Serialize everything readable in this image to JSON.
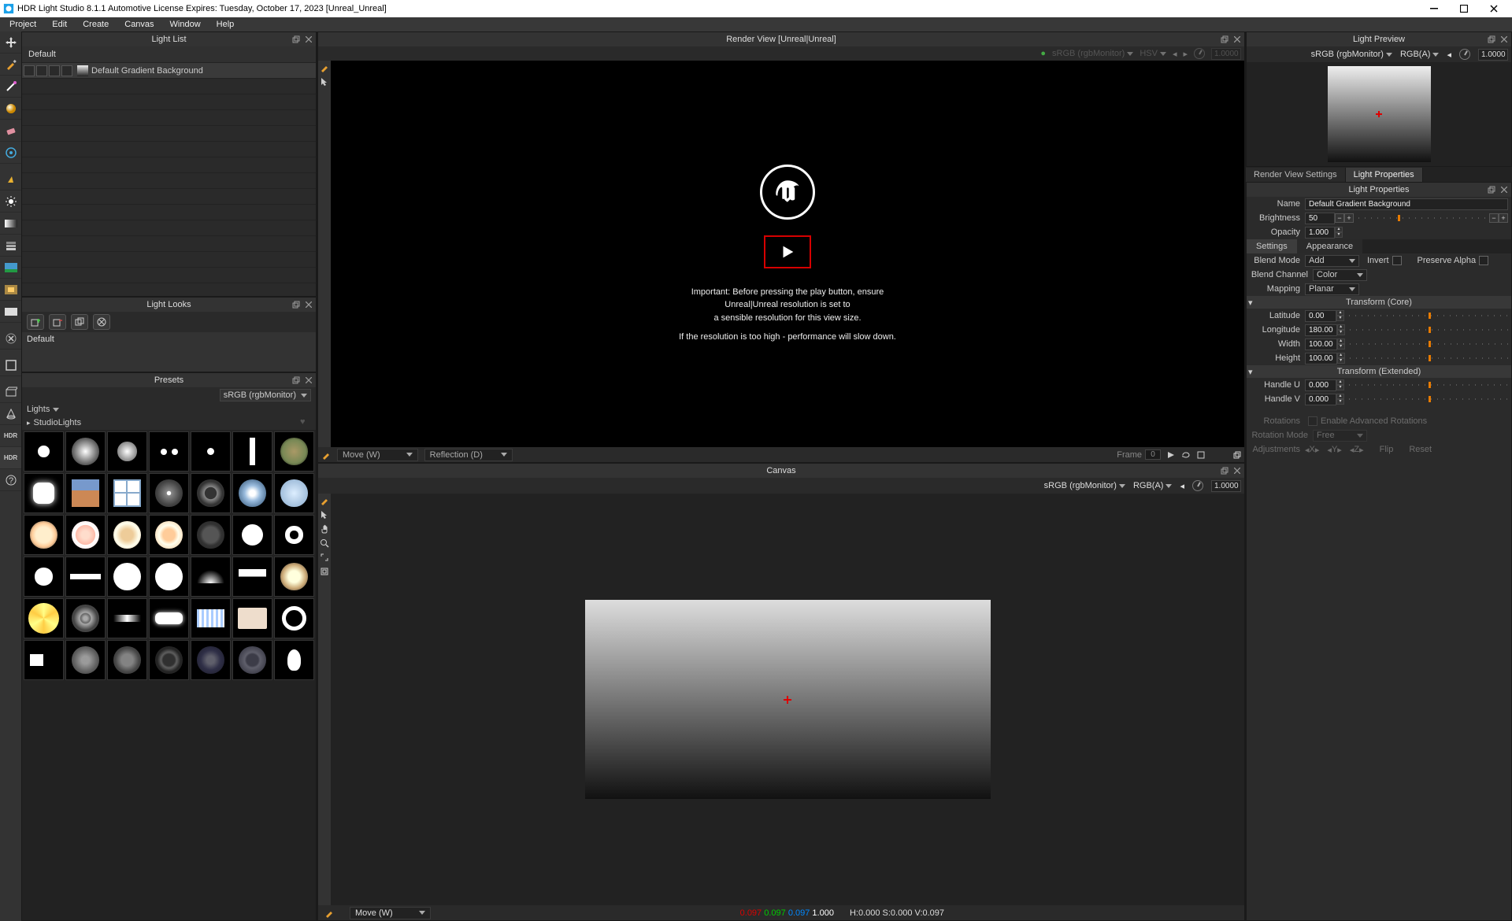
{
  "title": "HDR Light Studio 8.1.1  Automotive License Expires: Tuesday, October 17, 2023  [Unreal_Unreal]",
  "menu": [
    "Project",
    "Edit",
    "Create",
    "Canvas",
    "Window",
    "Help"
  ],
  "lightlist": {
    "title": "Light List",
    "default": "Default",
    "row0": "Default Gradient Background"
  },
  "lightlooks": {
    "title": "Light Looks",
    "default": "Default"
  },
  "presets": {
    "title": "Presets",
    "colorspace": "sRGB (rgbMonitor)",
    "category": "Lights",
    "subcategory": "StudioLights"
  },
  "renderview": {
    "title": "Render View [Unreal|Unreal]",
    "colorspace": "sRGB (rgbMonitor)",
    "hsv": "HSV",
    "expo": "1.0000",
    "msg1": "Important: Before pressing the play button, ensure",
    "msg2": "Unreal|Unreal resolution is set to",
    "msg3": "a sensible resolution for this view size.",
    "msg4": "If the resolution is too high - performance will slow down.",
    "footer_mode": "Move (W)",
    "footer_refl": "Reflection (D)",
    "footer_frame_lbl": "Frame",
    "footer_frame_val": "0"
  },
  "canvas": {
    "title": "Canvas",
    "colorspace": "sRGB (rgbMonitor)",
    "rgba": "RGB(A)",
    "expo": "1.0000",
    "footer_mode": "Move (W)",
    "rgb_r": "0.097",
    "rgb_g": "0.097",
    "rgb_b": "0.097",
    "rgb_a": "1.000",
    "hsv": "H:0.000 S:0.000 V:0.097"
  },
  "lightpreview": {
    "title": "Light Preview",
    "colorspace": "sRGB (rgbMonitor)",
    "rgba": "RGB(A)",
    "expo": "1.0000"
  },
  "tabs": {
    "rvs": "Render View Settings",
    "lp": "Light Properties"
  },
  "props": {
    "title": "Light Properties",
    "name_lbl": "Name",
    "name_val": "Default Gradient Background",
    "brightness_lbl": "Brightness",
    "brightness_val": "50",
    "opacity_lbl": "Opacity",
    "opacity_val": "1.000",
    "subtab_settings": "Settings",
    "subtab_appearance": "Appearance",
    "blendmode_lbl": "Blend Mode",
    "blendmode_val": "Add",
    "invert_lbl": "Invert",
    "preservealpha_lbl": "Preserve Alpha",
    "blendchannel_lbl": "Blend Channel",
    "blendchannel_val": "Color",
    "mapping_lbl": "Mapping",
    "mapping_val": "Planar",
    "section_core": "Transform (Core)",
    "lat_lbl": "Latitude",
    "lat_val": "0.00",
    "lon_lbl": "Longitude",
    "lon_val": "180.00",
    "width_lbl": "Width",
    "width_val": "100.00",
    "height_lbl": "Height",
    "height_val": "100.00",
    "section_ext": "Transform (Extended)",
    "hu_lbl": "Handle U",
    "hu_val": "0.000",
    "hv_lbl": "Handle V",
    "hv_val": "0.000",
    "rotations_lbl": "Rotations",
    "enable_adv_lbl": "Enable Advanced Rotations",
    "rotmode_lbl": "Rotation Mode",
    "rotmode_val": "Free",
    "adj_lbl": "Adjustments",
    "adjX": "X",
    "adjY": "Y",
    "adjZ": "Z",
    "flip_lbl": "Flip",
    "reset_lbl": "Reset"
  }
}
